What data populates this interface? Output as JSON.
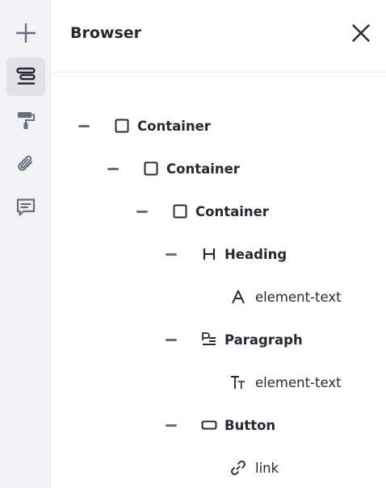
{
  "sidebar": {
    "items": [
      {
        "icon": "plus-icon",
        "active": false
      },
      {
        "icon": "browser-icon",
        "active": true
      },
      {
        "icon": "paint-roller-icon",
        "active": false
      },
      {
        "icon": "paperclip-icon",
        "active": false
      },
      {
        "icon": "comment-icon",
        "active": false
      }
    ]
  },
  "panel": {
    "title": "Browser",
    "close_icon": "close-icon"
  },
  "tree": [
    {
      "label": "Container",
      "icon": "square-icon",
      "depth": 0,
      "collapsible": true,
      "bold": true
    },
    {
      "label": "Container",
      "icon": "square-icon",
      "depth": 1,
      "collapsible": true,
      "bold": true
    },
    {
      "label": "Container",
      "icon": "square-icon",
      "depth": 2,
      "collapsible": true,
      "bold": true
    },
    {
      "label": "Heading",
      "icon": "heading-icon",
      "depth": 3,
      "collapsible": true,
      "bold": true
    },
    {
      "label": "element-text",
      "icon": "font-a-icon",
      "depth": 4,
      "collapsible": false,
      "bold": false
    },
    {
      "label": "Paragraph",
      "icon": "paragraph-icon",
      "depth": 3,
      "collapsible": true,
      "bold": true
    },
    {
      "label": "element-text",
      "icon": "text-size-icon",
      "depth": 4,
      "collapsible": false,
      "bold": false
    },
    {
      "label": "Button",
      "icon": "button-icon",
      "depth": 3,
      "collapsible": true,
      "bold": true
    },
    {
      "label": "link",
      "icon": "link-icon",
      "depth": 4,
      "collapsible": false,
      "bold": false
    }
  ],
  "colors": {
    "rail_bg": "#f1f2f5",
    "active_bg": "#e1e2e8",
    "text": "#272833",
    "icon": "#6b6c7e"
  }
}
